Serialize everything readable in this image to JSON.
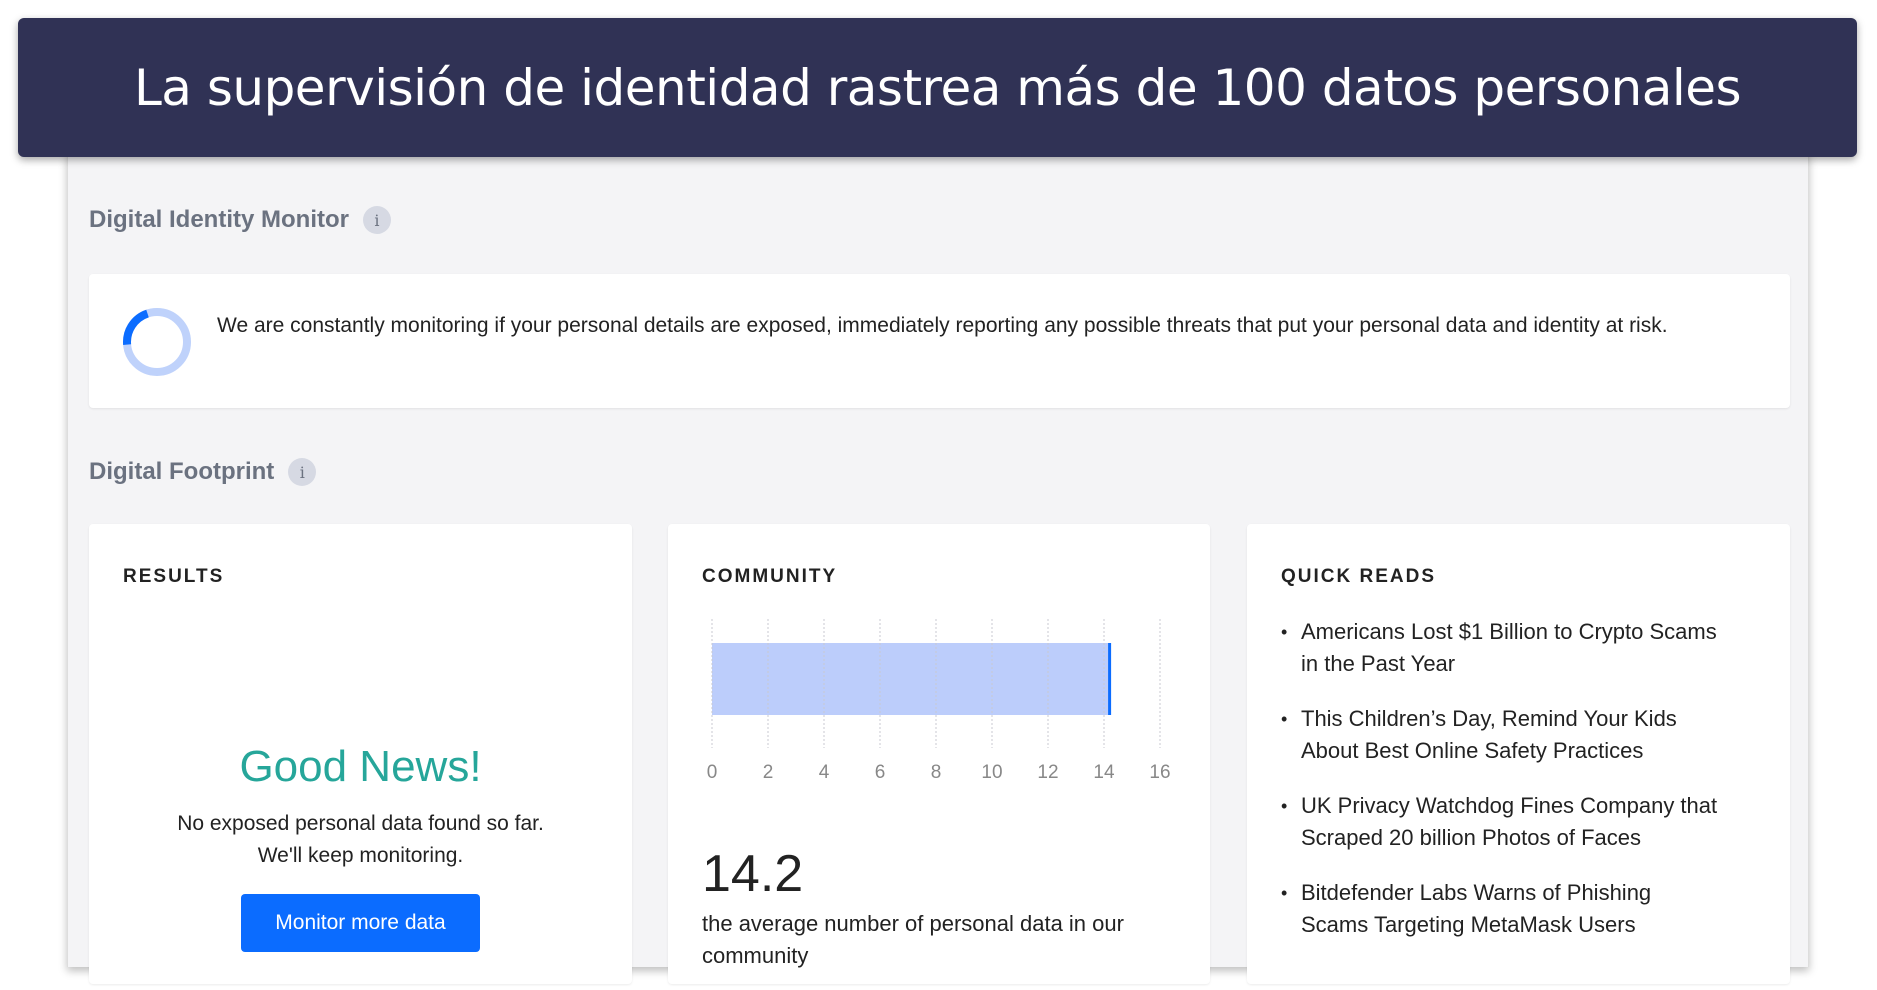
{
  "banner": {
    "title": "La supervisión de identidad rastrea más de 100 datos personales"
  },
  "identity_monitor": {
    "title": "Digital Identity Monitor",
    "info_icon": "info-icon",
    "text": "We are constantly monitoring if your personal details are exposed, immediately reporting any possible threats that put your personal data and identity at risk.",
    "spinner_colors": {
      "track": "#bfd2fb",
      "arc": "#0b6cff"
    }
  },
  "footprint": {
    "title": "Digital Footprint"
  },
  "results": {
    "title": "RESULTS",
    "headline": "Good News!",
    "line1": "No exposed personal data found so far.",
    "line2": "We'll keep monitoring.",
    "button": "Monitor more data"
  },
  "community": {
    "title": "COMMUNITY",
    "value": "14.2",
    "caption": "the average number of personal data in our community"
  },
  "chart_data": {
    "type": "bar",
    "orientation": "horizontal",
    "values": [
      14.2
    ],
    "xlim": [
      0,
      16
    ],
    "ticks": [
      "0",
      "2",
      "4",
      "6",
      "8",
      "10",
      "12",
      "14",
      "16"
    ],
    "grid": true,
    "colors": {
      "bar": "#bccdfb",
      "marker": "#0b6cff"
    }
  },
  "quick_reads": {
    "title": "QUICK READS",
    "items": [
      "Americans Lost $1 Billion to Crypto Scams in the Past Year",
      "This Children’s Day, Remind Your Kids About Best Online Safety Practices",
      "UK Privacy Watchdog Fines Company that Scraped 20 billion Photos of Faces",
      "Bitdefender Labs Warns of Phishing Scams Targeting MetaMask Users"
    ]
  },
  "colors": {
    "banner": "#303255",
    "accent": "#0b6cff",
    "good": "#26a69a"
  }
}
